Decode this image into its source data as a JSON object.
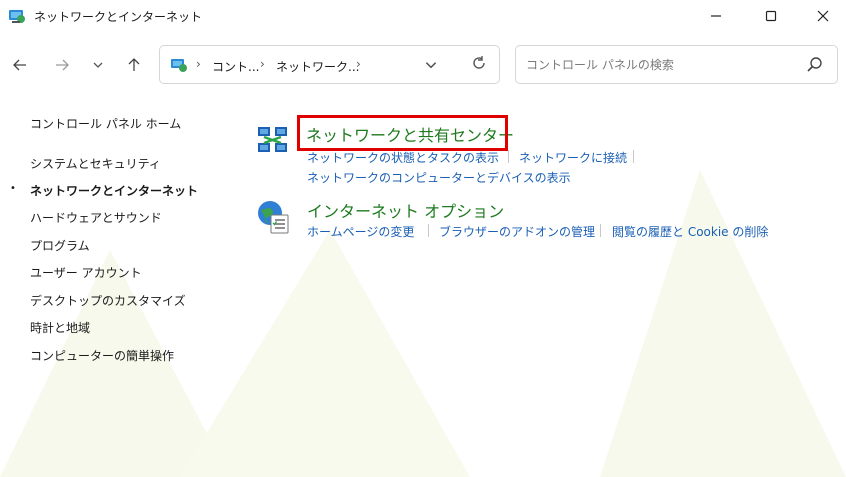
{
  "window": {
    "title": "ネットワークとインターネット",
    "controls": {
      "minimize": "—",
      "maximize": "☐",
      "close": "✕"
    }
  },
  "nav": {
    "back": "←",
    "forward": "→",
    "recent": "∨",
    "up": "↑",
    "breadcrumb": [
      "コント...",
      "ネットワーク...",
      ""
    ],
    "separator": "›",
    "dropdown": "∨",
    "refresh": "↻"
  },
  "search": {
    "placeholder": "コントロール パネルの検索"
  },
  "sidebar": {
    "home": "コントロール パネル ホーム",
    "items": [
      {
        "label": "システムとセキュリティ"
      },
      {
        "label": "ネットワークとインターネット",
        "current": true
      },
      {
        "label": "ハードウェアとサウンド"
      },
      {
        "label": "プログラム"
      },
      {
        "label": "ユーザー アカウント"
      },
      {
        "label": "デスクトップのカスタマイズ"
      },
      {
        "label": "時計と地域"
      },
      {
        "label": "コンピューターの簡単操作"
      }
    ],
    "bullet": "•"
  },
  "categories": [
    {
      "title": "ネットワークと共有センター",
      "links": [
        "ネットワークの状態とタスクの表示",
        "ネットワークに接続",
        "ネットワークのコンピューターとデバイスの表示"
      ]
    },
    {
      "title": "インターネット オプション",
      "links": [
        "ホームページの変更",
        "ブラウザーのアドオンの管理",
        "閲覧の履歴と Cookie の削除"
      ]
    }
  ],
  "colors": {
    "link": "#1a5fb4",
    "category_title": "#1e7a1e",
    "highlight_box": "#e00000"
  }
}
